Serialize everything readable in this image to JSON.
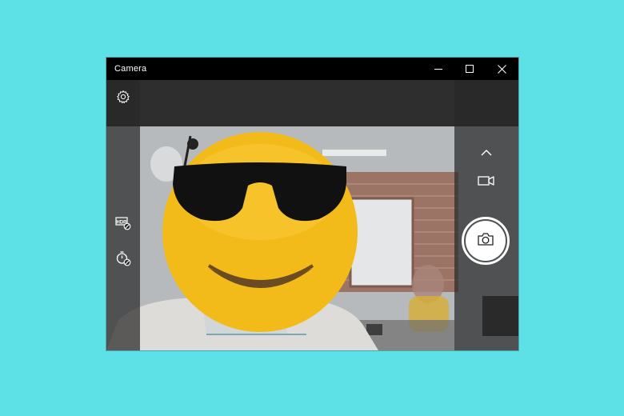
{
  "window": {
    "title": "Camera",
    "controls": [
      "minimize-icon",
      "maximize-icon",
      "close-icon"
    ]
  },
  "left_toolbar": {
    "icons": [
      "settings-gear-icon",
      "hdr-off-icon",
      "photo-timer-off-icon"
    ]
  },
  "right_toolbar": {
    "icons": [
      "chevron-up-icon",
      "video-mode-icon",
      "take-photo-camera-icon"
    ]
  },
  "colors": {
    "desktop_background": "#5ee1e6",
    "titlebar": "#000000",
    "toolbar_overlay": "#282828",
    "shutter": "#ffffff"
  }
}
